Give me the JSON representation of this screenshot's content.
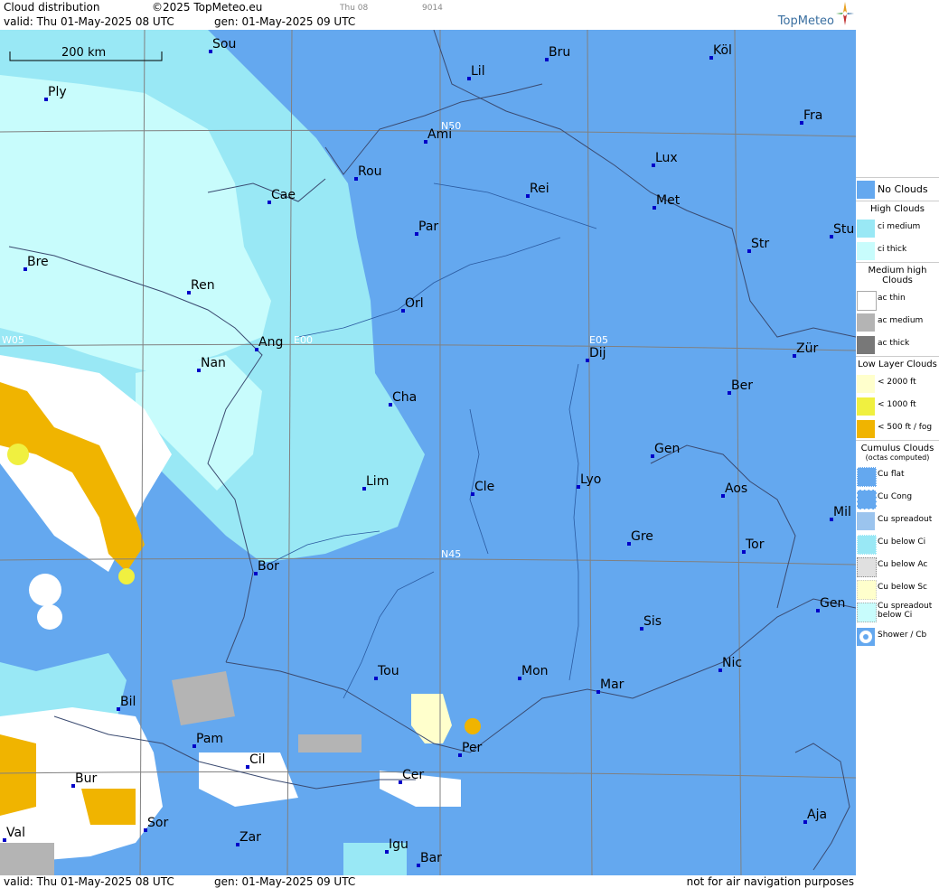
{
  "header": {
    "title": "Cloud distribution",
    "copyright": "©2025 TopMeteo.eu",
    "valid": "valid:  Thu  01-May-2025  08 UTC",
    "gen": "gen: 01-May-2025 09 UTC",
    "small1": "Thu 08",
    "small2": "9014",
    "logo": "TopMeteo"
  },
  "map": {
    "scale": "200 km",
    "grid_labels": [
      "N50",
      "N45",
      "W05",
      "E00",
      "E05"
    ],
    "cities": [
      "Sou",
      "Bru",
      "Köl",
      "Lil",
      "Ply",
      "Ami",
      "Fra",
      "Lux",
      "Rou",
      "Cae",
      "Rei",
      "Met",
      "Par",
      "Stu",
      "Str",
      "Bre",
      "Ren",
      "Orl",
      "Ang",
      "Dij",
      "Zür",
      "Nan",
      "Ber",
      "Cha",
      "Gen",
      "Lim",
      "Cle",
      "Lyo",
      "Aos",
      "Mil",
      "Gre",
      "Tor",
      "Bor",
      "Gen",
      "Sis",
      "Nic",
      "Tou",
      "Mon",
      "Mar",
      "Bil",
      "Per",
      "Pam",
      "Cil",
      "Cer",
      "Bur",
      "Sor",
      "Val",
      "Zar",
      "Aja",
      "Igu",
      "Bar"
    ]
  },
  "legend": {
    "no_clouds": "No Clouds",
    "high_title": "High Clouds",
    "high": [
      "ci medium",
      "ci thick"
    ],
    "medium_title": "Medium high Clouds",
    "medium": [
      "ac thin",
      "ac medium",
      "ac thick"
    ],
    "low_title": "Low Layer Clouds",
    "low": [
      "< 2000 ft",
      "< 1000 ft",
      "< 500 ft / fog"
    ],
    "cumulus_title": "Cumulus Clouds",
    "cumulus_sub": "(octas computed)",
    "cumulus": [
      "Cu flat",
      "Cu Cong",
      "Cu spreadout",
      "Cu below Ci",
      "Cu below Ac",
      "Cu below Sc",
      "Cu spreadout below Ci",
      "Shower / Cb"
    ],
    "colors": {
      "no_clouds": "#64a8ef",
      "ci_medium": "#99e8f5",
      "ci_thick": "#c8fcfc",
      "ac_thin": "#ffffff",
      "ac_medium": "#b4b4b4",
      "ac_thick": "#787878",
      "low_2000": "#ffffcc",
      "low_1000": "#f0f040",
      "low_500": "#f0b400"
    }
  },
  "footer": {
    "valid": "valid:  Thu  01-May-2025  08 UTC",
    "gen": "gen: 01-May-2025 09 UTC",
    "note": "not for air navigation purposes"
  }
}
